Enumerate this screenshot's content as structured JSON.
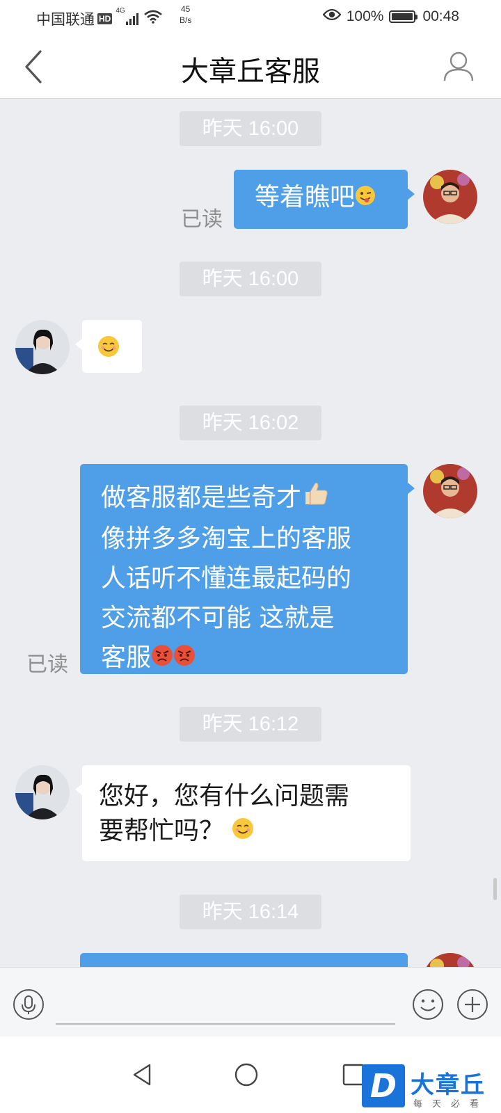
{
  "status_bar": {
    "carrier": "中国联通",
    "hd": "HD",
    "network": "4G",
    "net_speed_value": "45",
    "net_speed_unit": "B/s",
    "battery": "100%",
    "time": "00:48",
    "icons": [
      "signal-icon",
      "wifi-icon",
      "eye-icon",
      "battery-icon"
    ]
  },
  "header": {
    "title": "大章丘客服",
    "back_icon": "chevron-left-icon",
    "profile_icon": "person-icon"
  },
  "messages": [
    {
      "type": "time",
      "text": "昨天 16:00"
    },
    {
      "type": "sent",
      "text": "等着瞧吧",
      "emoji": [
        "tongue-wink"
      ],
      "read": "已读"
    },
    {
      "type": "time",
      "text": "昨天 16:00"
    },
    {
      "type": "received",
      "text": "",
      "emoji": [
        "smile"
      ]
    },
    {
      "type": "time",
      "text": "昨天 16:02"
    },
    {
      "type": "sent",
      "lines": [
        "做客服都是些奇才",
        "像拼多多淘宝上的客服",
        "人话听不懂连最起码的",
        "交流都不可能 这就是",
        "客服"
      ],
      "emoji": [
        "thumbs-up",
        "angry",
        "angry"
      ],
      "read": "已读"
    },
    {
      "type": "time",
      "text": "昨天 16:12"
    },
    {
      "type": "received",
      "lines": [
        "您好，您有什么问题需",
        "要帮忙吗？"
      ],
      "emoji": [
        "smile"
      ]
    },
    {
      "type": "time",
      "text": "昨天 16:14"
    }
  ],
  "input_bar": {
    "placeholder": "",
    "icons": [
      "mic-icon",
      "emoji-icon",
      "plus-icon"
    ]
  },
  "system_nav": [
    "back-triangle-icon",
    "home-circle-icon",
    "recents-square-icon"
  ],
  "watermark": {
    "letter": "D",
    "name": "大章丘",
    "slogan": "每天必看"
  },
  "colors": {
    "sent_bubble": "#4f9fe8",
    "received_bubble": "#ffffff",
    "chat_background": "#ebedf0",
    "brand": "#1a73d9"
  }
}
